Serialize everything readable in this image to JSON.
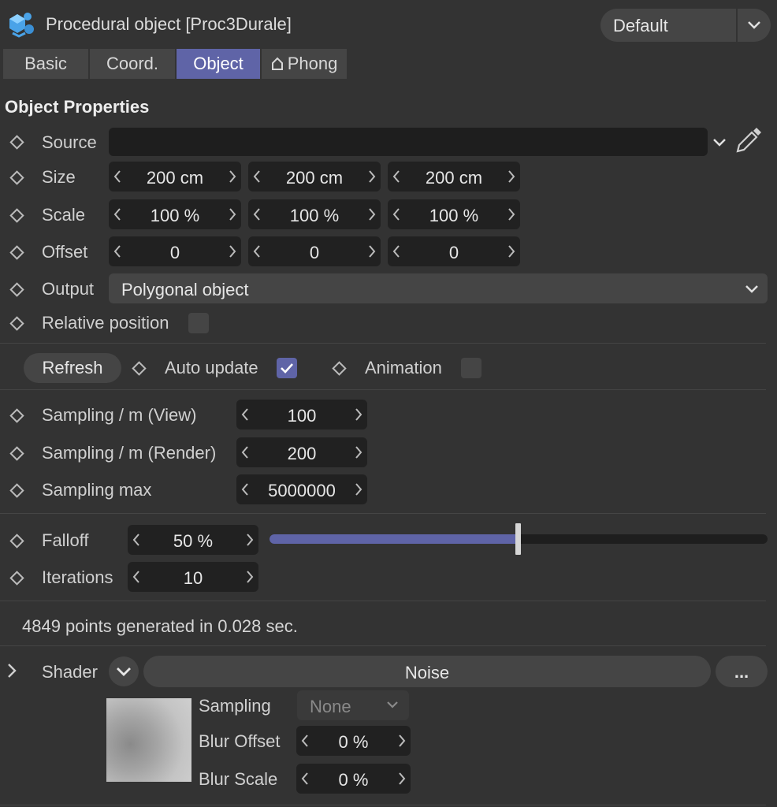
{
  "header": {
    "title": "Procedural object [Proc3Durale]",
    "preset": "Default",
    "app_icon": "procedural-object-icon"
  },
  "tabs": [
    {
      "label": "Basic",
      "active": false
    },
    {
      "label": "Coord.",
      "active": false
    },
    {
      "label": "Object",
      "active": true
    },
    {
      "label": "Phong",
      "active": false,
      "icon": "phong-icon"
    }
  ],
  "section": {
    "title": "Object Properties"
  },
  "source": {
    "label": "Source",
    "value": ""
  },
  "size": {
    "label": "Size",
    "values": [
      "200 cm",
      "200 cm",
      "200 cm"
    ]
  },
  "scale": {
    "label": "Scale",
    "values": [
      "100 %",
      "100 %",
      "100 %"
    ]
  },
  "offset": {
    "label": "Offset",
    "values": [
      "0",
      "0",
      "0"
    ]
  },
  "output": {
    "label": "Output",
    "value": "Polygonal object"
  },
  "relative_position": {
    "label": "Relative position",
    "checked": false
  },
  "refresh": {
    "label": "Refresh"
  },
  "auto_update": {
    "label": "Auto update",
    "checked": true
  },
  "animation": {
    "label": "Animation",
    "checked": false
  },
  "sampling_view": {
    "label": "Sampling / m (View)",
    "value": "100"
  },
  "sampling_render": {
    "label": "Sampling / m (Render)",
    "value": "200"
  },
  "sampling_max": {
    "label": "Sampling max",
    "value": "5000000"
  },
  "falloff": {
    "label": "Falloff",
    "value": "50 %",
    "slider_fraction": 0.5
  },
  "iterations": {
    "label": "Iterations",
    "value": "10"
  },
  "status": "4849 points generated in 0.028 sec.",
  "shader": {
    "label": "Shader",
    "name": "Noise",
    "more_label": "...",
    "sampling": {
      "label": "Sampling",
      "value": "None"
    },
    "blur_offset": {
      "label": "Blur Offset",
      "value": "0 %"
    },
    "blur_scale": {
      "label": "Blur Scale",
      "value": "0 %"
    }
  },
  "colors": {
    "accent": "#5f64a7",
    "panel": "#333333",
    "control": "#454545",
    "field": "#212121"
  }
}
